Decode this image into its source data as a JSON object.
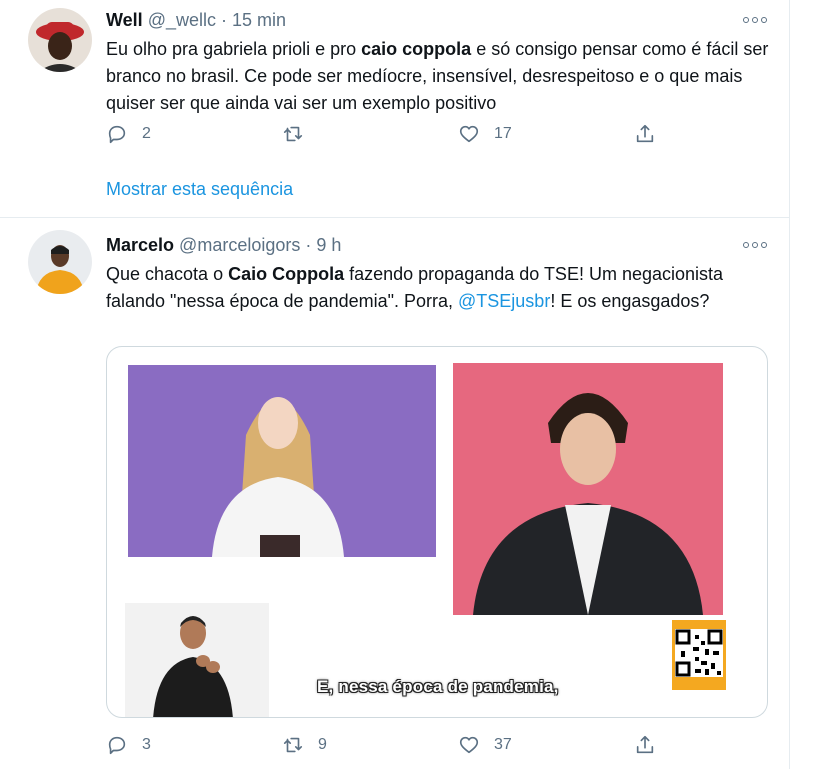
{
  "tweets": [
    {
      "name": "Well",
      "handle": "@_wellc",
      "dot": "·",
      "time": "15 min",
      "text_1": "Eu olho pra gabriela prioli e pro ",
      "text_bold": "caio coppola",
      "text_2": " e só consigo pensar como é fácil ser branco no brasil. Ce pode ser medíocre, insensível, desrespeitoso e o que mais quiser ser que ainda vai ser um exemplo positivo",
      "replies": "2",
      "retweets": "",
      "likes": "17",
      "show_thread": "Mostrar esta sequência"
    },
    {
      "name": "Marcelo",
      "handle": "@marceloigors",
      "dot": "·",
      "time": "9 h",
      "text_1": "Que chacota o ",
      "text_bold": "Caio Coppola",
      "text_2": " fazendo propaganda do TSE! Um negacionista falando \"nessa época de pandemia\". Porra, ",
      "mention": "@TSEjusbr",
      "text_3": "! E os engasgados?",
      "media_subtitle": "E, nessa época de pandemia,",
      "replies": "3",
      "retweets": "9",
      "likes": "37"
    }
  ],
  "icons": [
    "more-icon",
    "reply-icon",
    "retweet-icon",
    "like-icon",
    "share-icon",
    "qr-code"
  ],
  "colors": {
    "link": "#1b95e0",
    "muted": "#5b7083",
    "border": "#e6ecf0",
    "media_purple": "#8a6cc2",
    "media_pink": "#e6687f",
    "qr_orange": "#f4a820"
  }
}
